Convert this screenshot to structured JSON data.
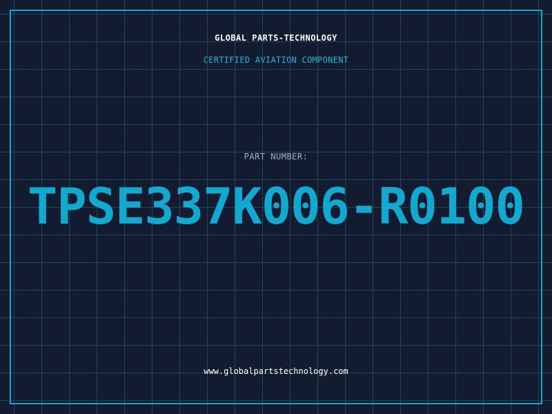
{
  "header": {
    "company": "GLOBAL PARTS-TECHNOLOGY",
    "subtitle": "CERTIFIED AVIATION COMPONENT"
  },
  "part": {
    "label": "PART NUMBER:",
    "number": "TPSE337K006-R0100"
  },
  "footer": {
    "website": "www.globalpartstechnology.com"
  },
  "colors": {
    "background": "#121b2f",
    "grid": "#1b4a5c",
    "accent": "#14a7cf",
    "text": "#ffffff",
    "muted": "#a9b1bd"
  }
}
